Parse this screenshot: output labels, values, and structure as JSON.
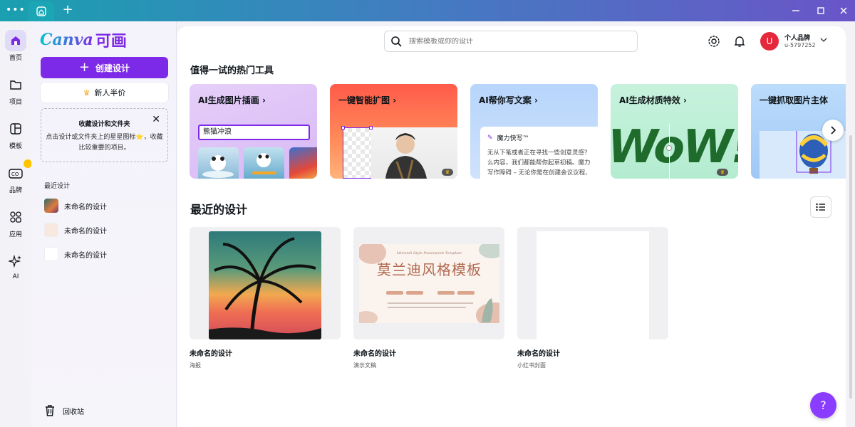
{
  "window": {
    "menu_dots": "•••",
    "new_tab": "+",
    "minimize_icon": "minimize-icon",
    "maximize_icon": "maximize-icon",
    "close_icon": "close-icon"
  },
  "rail": {
    "items": [
      {
        "label": "首页",
        "icon": "home-icon"
      },
      {
        "label": "项目",
        "icon": "folder-icon"
      },
      {
        "label": "模板",
        "icon": "template-icon"
      },
      {
        "label": "品牌",
        "icon": "brand-icon"
      },
      {
        "label": "应用",
        "icon": "apps-icon"
      },
      {
        "label": "AI",
        "icon": "sparkle-icon"
      }
    ]
  },
  "side": {
    "logo_text": "Canva",
    "logo_cn": "可画",
    "create_button": "创建设计",
    "halfprice_button": "新人半价",
    "collect_title": "收藏设计和文件夹",
    "collect_desc": "点击设计或文件夹上的星星图标⭐，收藏比较重要的项目。",
    "recent_heading": "最近设计",
    "recent_items": [
      "未命名的设计",
      "未命名的设计",
      "未命名的设计"
    ],
    "trash_label": "回收站"
  },
  "header": {
    "search_placeholder": "搜索模板或你的设计",
    "account_name": "个人品牌",
    "account_id": "u-5797252",
    "avatar_letter": "U"
  },
  "tools": {
    "heading": "值得一试的热门工具",
    "cards": [
      {
        "title": "AI生成图片插画",
        "input_text": "熊猫冲浪"
      },
      {
        "title": "一键智能扩图"
      },
      {
        "title": "AI帮你写文案",
        "inner_title": "魔力快写™",
        "inner_text": "无从下笔或者正在寻找一些创意灵感？么内容，我们都能帮你起草初稿。魔力写作障碍 – 无论你是在创建会议议程、"
      },
      {
        "title": "AI生成材质特效",
        "art_text": "WoW!"
      },
      {
        "title": "一键抓取图片主体"
      }
    ]
  },
  "recent": {
    "heading": "最近的设计",
    "designs": [
      {
        "name": "未命名的设计",
        "type": "海报"
      },
      {
        "name": "未命名的设计",
        "type": "演示文稿",
        "thumb_title": "莫兰迪风格模板",
        "thumb_sub": "Morandi Style Powerpoint Template"
      },
      {
        "name": "未命名的设计",
        "type": "小红书封面"
      }
    ]
  },
  "help_label": "?",
  "colors": {
    "accent": "#7d2ae8",
    "help": "#8b3dff",
    "avatar": "#e5283b"
  }
}
